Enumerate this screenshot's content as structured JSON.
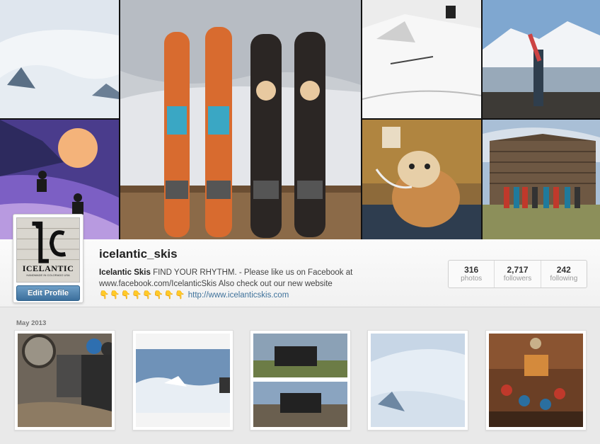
{
  "profile": {
    "username": "icelantic_skis",
    "bio_name": "Icelantic Skis",
    "bio_text": "FIND YOUR RHYTHM. - Please like us on Facebook at www.facebook.com/IcelanticSkis Also check out our new website",
    "bio_emoji": "👇👇👇👇👇👇👇👇",
    "website": "http://www.icelanticskis.com",
    "edit_button": "Edit Profile",
    "avatar_text": "ICELANTIC",
    "avatar_subtext": "HANDMADE IN COLORADO USA"
  },
  "stats": [
    {
      "value": "316",
      "label": "photos"
    },
    {
      "value": "2,717",
      "label": "followers"
    },
    {
      "value": "242",
      "label": "following"
    }
  ],
  "feed": {
    "month_label": "May 2013",
    "photos": [
      {
        "subject": "ski-workshop-photo"
      },
      {
        "subject": "snow-kicker-photo"
      },
      {
        "subject": "jeep-collage-photo"
      },
      {
        "subject": "snowy-slope-photo"
      },
      {
        "subject": "cabin-gathering-photo"
      }
    ]
  },
  "mosaic_photos": [
    "snow-slope-photo",
    "skis-on-railing-photo",
    "terrain-park-photo",
    "skier-on-shore-photo",
    "sunset-skiers-photo",
    "bulldog-photo",
    "log-cabin-group-photo"
  ],
  "colors": {
    "link": "#3f729b",
    "button": "#3c6f9c"
  }
}
